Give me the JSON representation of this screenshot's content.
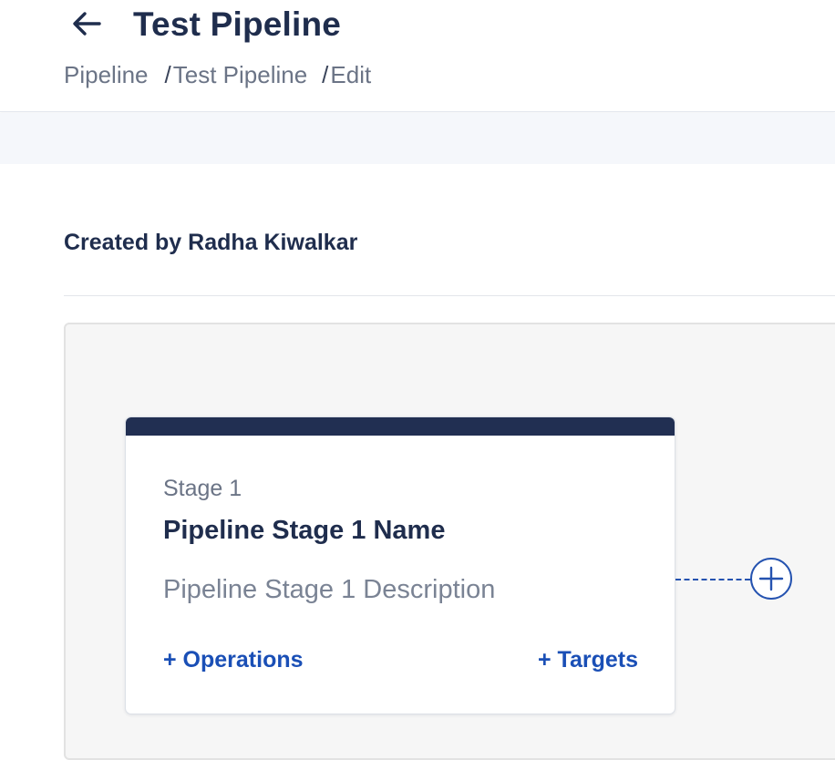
{
  "header": {
    "title": "Test Pipeline",
    "back_icon": "arrow-left-icon",
    "breadcrumb": [
      {
        "label": "Pipeline"
      },
      {
        "sep": "/",
        "label": "Test Pipeline"
      },
      {
        "sep": "/",
        "label": "Edit"
      }
    ]
  },
  "meta": {
    "created_by": "Created by Radha Kiwalkar"
  },
  "stages": [
    {
      "number_label": "Stage 1",
      "name": "Pipeline Stage 1 Name",
      "description": "Pipeline Stage 1 Description",
      "operations_label": "+ Operations",
      "targets_label": "+ Targets"
    }
  ],
  "add_stage_icon": "plus-circle-icon",
  "colors": {
    "brand_dark": "#212f52",
    "link_blue": "#1a4fb6",
    "text_dark": "#1f2d4d",
    "text_muted": "#6b7486"
  }
}
